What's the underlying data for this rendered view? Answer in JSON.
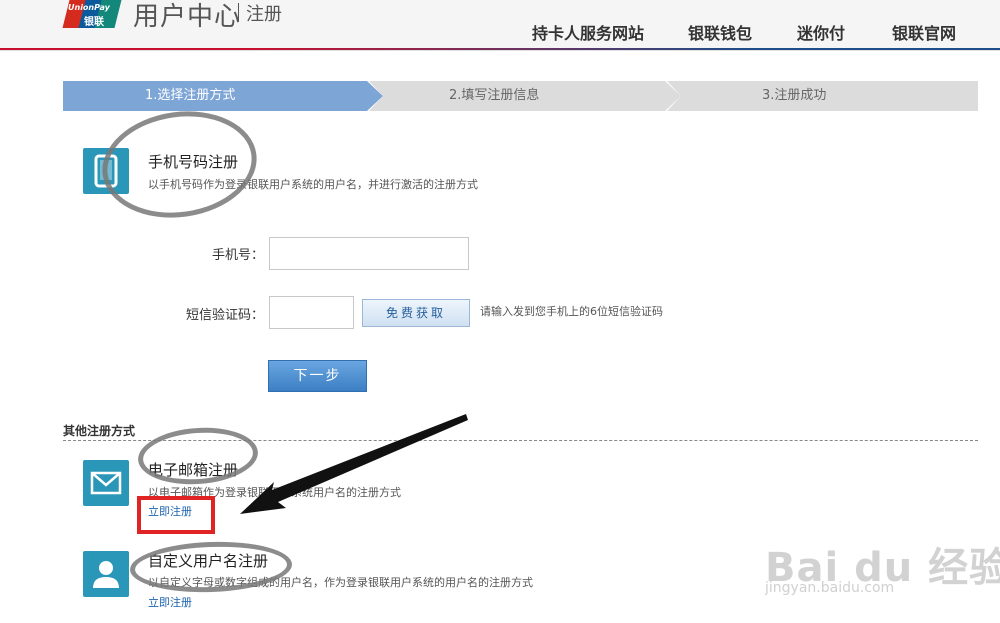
{
  "header": {
    "logo_text_1": "UnionPay",
    "logo_text_2": "银联",
    "title": "用户中心",
    "subtitle": "注册",
    "nav": [
      "持卡人服务网站",
      "银联钱包",
      "迷你付",
      "银联官网"
    ]
  },
  "steps": [
    "1.选择注册方式",
    "2.填写注册信息",
    "3.注册成功"
  ],
  "phone_reg": {
    "title": "手机号码注册",
    "desc": "以手机号码作为登录银联用户系统的用户名，并进行激活的注册方式",
    "phone_label": "手机号：",
    "phone_value": "",
    "sms_label": "短信验证码：",
    "sms_value": "",
    "get_code_button": "免费获取",
    "hint": "请输入发到您手机上的6位短信验证码",
    "next_button": "下一步"
  },
  "other": {
    "label": "其他注册方式",
    "email": {
      "title": "电子邮箱注册",
      "desc": "以电子邮箱作为登录银联用户系统用户名的注册方式",
      "link": "立即注册"
    },
    "custom": {
      "title": "自定义用户名注册",
      "desc": "以自定义字母或数字组成的用户名，作为登录银联用户系统的用户名的注册方式",
      "link": "立即注册"
    }
  },
  "watermark": {
    "main": "Bai du 经验",
    "sub": "jingyan.baidu.com"
  },
  "colors": {
    "step_active": "#7da5d6",
    "step_inactive": "#dcdcdc",
    "icon_bg": "#2a97b8",
    "link": "#1e63b0",
    "annotation_red": "#e02424"
  }
}
